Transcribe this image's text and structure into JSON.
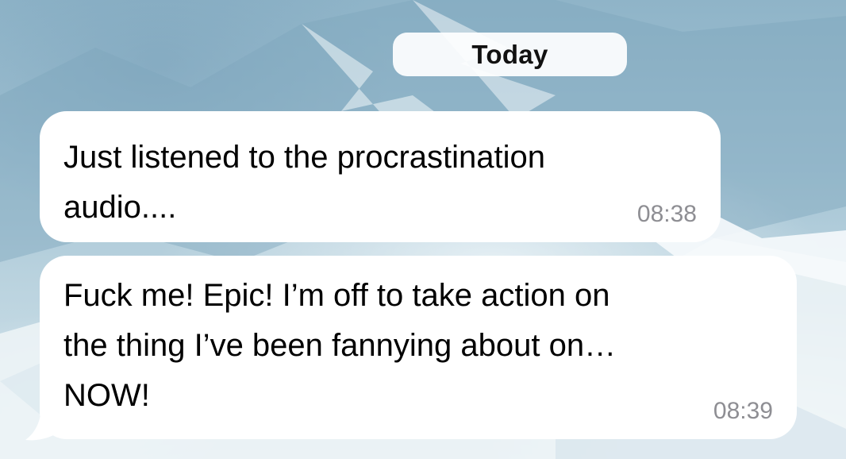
{
  "chat": {
    "date_label": "Today",
    "messages": [
      {
        "text": "Just listened to the procrastination\naudio....",
        "time": "08:38"
      },
      {
        "text": "Fuck me! Epic! I’m off to take action on\nthe thing I’ve been fannying about on…\nNOW!",
        "time": "08:39"
      }
    ]
  },
  "colors": {
    "bubble": "#ffffff",
    "timestamp": "#8e8e93",
    "date_pill": "#ffffff"
  }
}
